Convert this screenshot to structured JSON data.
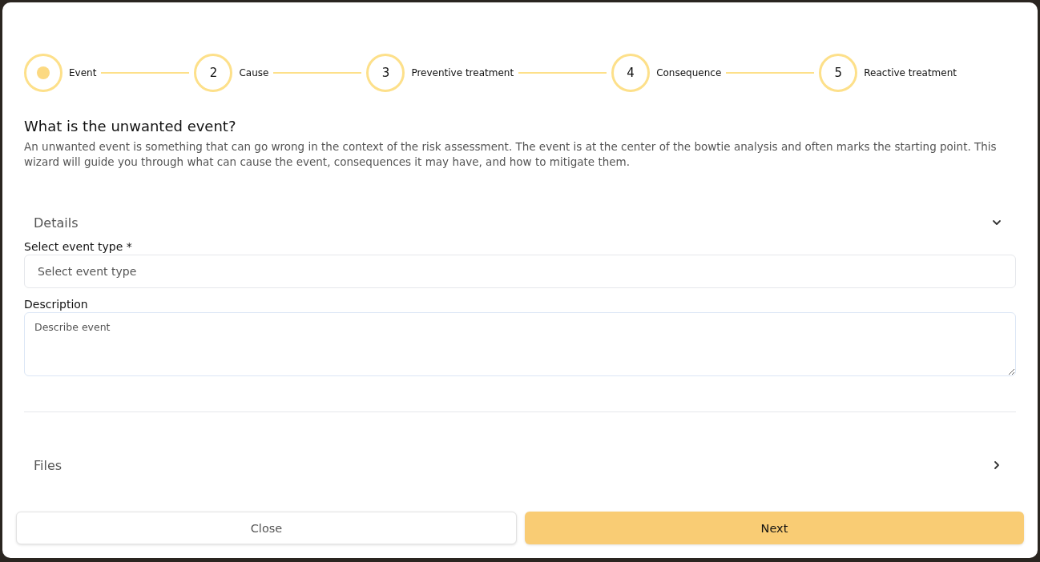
{
  "steps": [
    {
      "label": "Event",
      "selected": true
    },
    {
      "number": "2",
      "label": "Cause",
      "selected": false
    },
    {
      "number": "3",
      "label": "Preventive treatment",
      "selected": false
    },
    {
      "number": "4",
      "label": "Consequence",
      "selected": false
    },
    {
      "number": "5",
      "label": "Reactive treatment",
      "selected": false
    }
  ],
  "heading": "What is the unwanted event?",
  "intro": "An unwanted event is something that can go wrong in the context of the risk assessment. The event is at the center of the bowtie analysis and often marks the starting point. This wizard will guide you through what can cause the event, consequences it may have, and how to mitigate them.",
  "sections": [
    {
      "title": "Details",
      "expanded": true
    },
    {
      "title": "Files",
      "expanded": false
    }
  ],
  "fields": [
    {
      "kind": "select",
      "label": "Select event type *",
      "placeholder": "Select event type"
    },
    {
      "kind": "textarea",
      "label": "Description",
      "placeholder": "Describe event"
    }
  ],
  "buttons": {
    "close": "Close",
    "next": "Next"
  }
}
